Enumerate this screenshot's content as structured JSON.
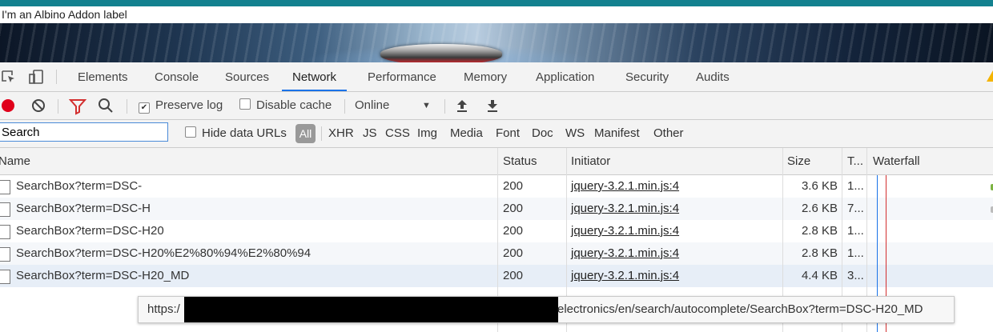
{
  "addon_label": "I'm an Albino Addon label",
  "devtools": {
    "tabs": [
      "Elements",
      "Console",
      "Sources",
      "Network",
      "Performance",
      "Memory",
      "Application",
      "Security",
      "Audits"
    ],
    "active_tab": "Network"
  },
  "toolbar": {
    "preserve_log_label": "Preserve log",
    "preserve_log_checked": true,
    "disable_cache_label": "Disable cache",
    "disable_cache_checked": false,
    "throttle_value": "Online"
  },
  "filter": {
    "search_value": "Search",
    "hide_data_urls_label": "Hide data URLs",
    "types": [
      "All",
      "XHR",
      "JS",
      "CSS",
      "Img",
      "Media",
      "Font",
      "Doc",
      "WS",
      "Manifest",
      "Other"
    ],
    "active_type": "All"
  },
  "table": {
    "columns": [
      "Name",
      "Status",
      "Initiator",
      "Size",
      "T...",
      "Waterfall"
    ],
    "rows": [
      {
        "name": "SearchBox?term=DSC-",
        "status": "200",
        "initiator": "jquery-3.2.1.min.js:4",
        "size": "3.6 KB",
        "time": "1..."
      },
      {
        "name": "SearchBox?term=DSC-H",
        "status": "200",
        "initiator": "jquery-3.2.1.min.js:4",
        "size": "2.6 KB",
        "time": "7..."
      },
      {
        "name": "SearchBox?term=DSC-H20",
        "status": "200",
        "initiator": "jquery-3.2.1.min.js:4",
        "size": "2.8 KB",
        "time": "1..."
      },
      {
        "name": "SearchBox?term=DSC-H20%E2%80%94%E2%80%94",
        "status": "200",
        "initiator": "jquery-3.2.1.min.js:4",
        "size": "2.8 KB",
        "time": "1..."
      },
      {
        "name": "SearchBox?term=DSC-H20_MD",
        "status": "200",
        "initiator": "jquery-3.2.1.min.js:4",
        "size": "4.4 KB",
        "time": "3..."
      }
    ]
  },
  "tooltip": {
    "prefix": "https:/",
    "suffix": "electronics/en/search/autocomplete/SearchBox?term=DSC-H20_MD"
  },
  "colors": {
    "accent_teal": "#13818f",
    "record_red": "#e0001b",
    "filter_red": "#d32f2f",
    "active_tab_blue": "#1a73e8",
    "waterfall_blue": "#1a73e8",
    "waterfall_red": "#d32f2f"
  },
  "icons": [
    "inspect-element-icon",
    "device-toolbar-icon",
    "record-icon",
    "clear-icon",
    "filter-icon",
    "search-icon",
    "import-har-icon",
    "export-har-icon",
    "warning-icon",
    "dropdown-arrow-icon"
  ]
}
